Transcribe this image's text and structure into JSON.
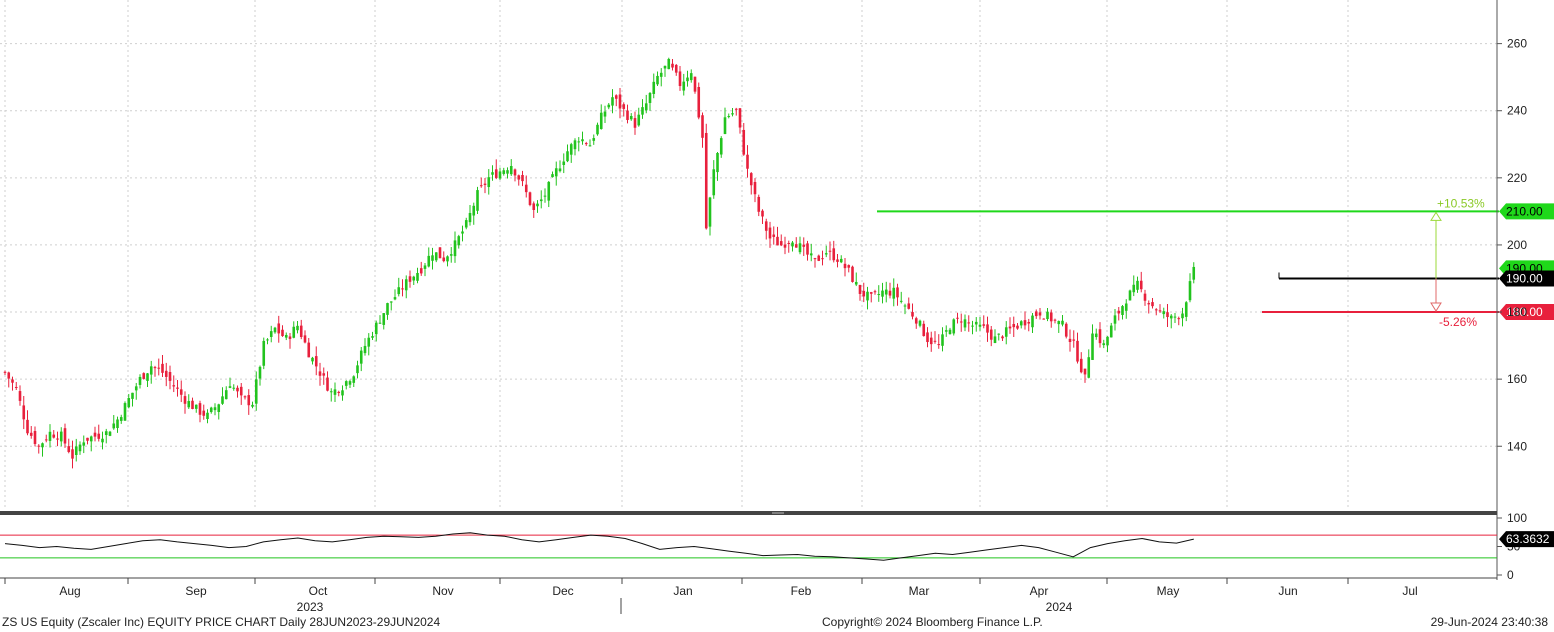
{
  "chart_data": {
    "type": "candlestick",
    "ticker": "ZS US Equity (Zscaler Inc) EQUITY PRICE CHART",
    "period": "Daily 28JUN2023-29JUN2024",
    "copyright": "Copyright© 2024 Bloomberg Finance L.P.",
    "timestamp": "29-Jun-2024 23:40:38",
    "colors": {
      "up": "#22c31e",
      "down": "#e8203c",
      "support": "#e8203c",
      "resistance": "#1fd81a",
      "pivot": "#000000"
    },
    "price_axis": {
      "ticks": [
        140,
        160,
        180,
        200,
        220,
        240,
        260
      ],
      "ylim": [
        121,
        273
      ],
      "grid": true
    },
    "month_labels": [
      "Aug",
      "Sep",
      "Oct",
      "Nov",
      "Dec",
      "Jan",
      "Feb",
      "Mar",
      "Apr",
      "May",
      "Jun",
      "Jul"
    ],
    "year_labels": [
      "2023",
      "2024"
    ],
    "close_path": [
      {
        "t": 0,
        "p": 162
      },
      {
        "t": 3,
        "p": 157
      },
      {
        "t": 6,
        "p": 145
      },
      {
        "t": 9,
        "p": 140
      },
      {
        "t": 12,
        "p": 144
      },
      {
        "t": 15,
        "p": 143
      },
      {
        "t": 18,
        "p": 137
      },
      {
        "t": 21,
        "p": 142
      },
      {
        "t": 24,
        "p": 143
      },
      {
        "t": 27,
        "p": 144
      },
      {
        "t": 30,
        "p": 148
      },
      {
        "t": 33,
        "p": 154
      },
      {
        "t": 36,
        "p": 160
      },
      {
        "t": 39,
        "p": 164
      },
      {
        "t": 42,
        "p": 162
      },
      {
        "t": 45,
        "p": 158
      },
      {
        "t": 48,
        "p": 154
      },
      {
        "t": 51,
        "p": 151
      },
      {
        "t": 54,
        "p": 149
      },
      {
        "t": 57,
        "p": 153
      },
      {
        "t": 60,
        "p": 159
      },
      {
        "t": 63,
        "p": 154
      },
      {
        "t": 66,
        "p": 153
      },
      {
        "t": 69,
        "p": 170
      },
      {
        "t": 72,
        "p": 175
      },
      {
        "t": 75,
        "p": 172
      },
      {
        "t": 78,
        "p": 176
      },
      {
        "t": 81,
        "p": 168
      },
      {
        "t": 84,
        "p": 162
      },
      {
        "t": 87,
        "p": 156
      },
      {
        "t": 90,
        "p": 158
      },
      {
        "t": 93,
        "p": 162
      },
      {
        "t": 96,
        "p": 170
      },
      {
        "t": 99,
        "p": 176
      },
      {
        "t": 102,
        "p": 182
      },
      {
        "t": 105,
        "p": 186
      },
      {
        "t": 108,
        "p": 190
      },
      {
        "t": 111,
        "p": 193
      },
      {
        "t": 114,
        "p": 198
      },
      {
        "t": 117,
        "p": 196
      },
      {
        "t": 120,
        "p": 200
      },
      {
        "t": 123,
        "p": 206
      },
      {
        "t": 126,
        "p": 215
      },
      {
        "t": 129,
        "p": 220
      },
      {
        "t": 132,
        "p": 222
      },
      {
        "t": 135,
        "p": 224
      },
      {
        "t": 138,
        "p": 218
      },
      {
        "t": 141,
        "p": 210
      },
      {
        "t": 144,
        "p": 215
      },
      {
        "t": 147,
        "p": 222
      },
      {
        "t": 150,
        "p": 228
      },
      {
        "t": 153,
        "p": 232
      },
      {
        "t": 156,
        "p": 230
      },
      {
        "t": 159,
        "p": 238
      },
      {
        "t": 162,
        "p": 244
      },
      {
        "t": 165,
        "p": 240
      },
      {
        "t": 168,
        "p": 236
      },
      {
        "t": 171,
        "p": 242
      },
      {
        "t": 174,
        "p": 250
      },
      {
        "t": 177,
        "p": 254
      },
      {
        "t": 180,
        "p": 248
      },
      {
        "t": 183,
        "p": 252
      },
      {
        "t": 186,
        "p": 232
      },
      {
        "t": 187,
        "p": 205
      },
      {
        "t": 189,
        "p": 222
      },
      {
        "t": 192,
        "p": 238
      },
      {
        "t": 195,
        "p": 240
      },
      {
        "t": 198,
        "p": 222
      },
      {
        "t": 201,
        "p": 210
      },
      {
        "t": 204,
        "p": 202
      },
      {
        "t": 207,
        "p": 200
      },
      {
        "t": 210,
        "p": 202
      },
      {
        "t": 213,
        "p": 198
      },
      {
        "t": 216,
        "p": 195
      },
      {
        "t": 219,
        "p": 198
      },
      {
        "t": 222,
        "p": 196
      },
      {
        "t": 225,
        "p": 192
      },
      {
        "t": 228,
        "p": 186
      },
      {
        "t": 231,
        "p": 184
      },
      {
        "t": 234,
        "p": 186
      },
      {
        "t": 237,
        "p": 186
      },
      {
        "t": 240,
        "p": 182
      },
      {
        "t": 243,
        "p": 178
      },
      {
        "t": 246,
        "p": 172
      },
      {
        "t": 249,
        "p": 170
      },
      {
        "t": 252,
        "p": 176
      },
      {
        "t": 255,
        "p": 178
      },
      {
        "t": 258,
        "p": 176
      },
      {
        "t": 261,
        "p": 175
      },
      {
        "t": 264,
        "p": 172
      },
      {
        "t": 267,
        "p": 174
      },
      {
        "t": 270,
        "p": 176
      },
      {
        "t": 273,
        "p": 178
      },
      {
        "t": 276,
        "p": 180
      },
      {
        "t": 279,
        "p": 178
      },
      {
        "t": 282,
        "p": 176
      },
      {
        "t": 285,
        "p": 170
      },
      {
        "t": 288,
        "p": 160
      },
      {
        "t": 290,
        "p": 175
      },
      {
        "t": 293,
        "p": 170
      },
      {
        "t": 296,
        "p": 178
      },
      {
        "t": 299,
        "p": 184
      },
      {
        "t": 302,
        "p": 188
      },
      {
        "t": 305,
        "p": 183
      },
      {
        "t": 308,
        "p": 180
      },
      {
        "t": 311,
        "p": 178
      },
      {
        "t": 314,
        "p": 180
      },
      {
        "t": 317,
        "p": 192
      }
    ],
    "lines": [
      {
        "name": "resistance",
        "value": 210,
        "label": "210.00",
        "pct_label": "+10.53%"
      },
      {
        "name": "pivot",
        "value": 190,
        "label": "190.00"
      },
      {
        "name": "support",
        "value": 180,
        "label": "180.00",
        "pct_label": "-5.26%"
      }
    ],
    "last_price_tag": "190.00",
    "rsi": {
      "ticks": [
        "100",
        "50",
        "0"
      ],
      "last_label": "63.3632",
      "upper_band": 70,
      "lower_band": 30,
      "values": [
        55,
        52,
        48,
        50,
        47,
        45,
        50,
        55,
        60,
        62,
        58,
        55,
        52,
        48,
        50,
        58,
        62,
        65,
        60,
        58,
        62,
        66,
        68,
        67,
        66,
        68,
        72,
        74,
        70,
        68,
        62,
        58,
        62,
        66,
        70,
        68,
        64,
        55,
        45,
        48,
        50,
        46,
        42,
        38,
        34,
        35,
        36,
        33,
        32,
        30,
        28,
        26,
        30,
        34,
        38,
        36,
        40,
        44,
        48,
        52,
        48,
        40,
        32,
        48,
        55,
        60,
        64,
        58,
        56,
        63
      ]
    }
  },
  "footer": {
    "left": "ZS US Equity (Zscaler Inc) EQUITY PRICE CHART  Daily 28JUN2023-29JUN2024",
    "center": "Copyright© 2024 Bloomberg Finance L.P.",
    "right": "29-Jun-2024 23:40:38"
  }
}
